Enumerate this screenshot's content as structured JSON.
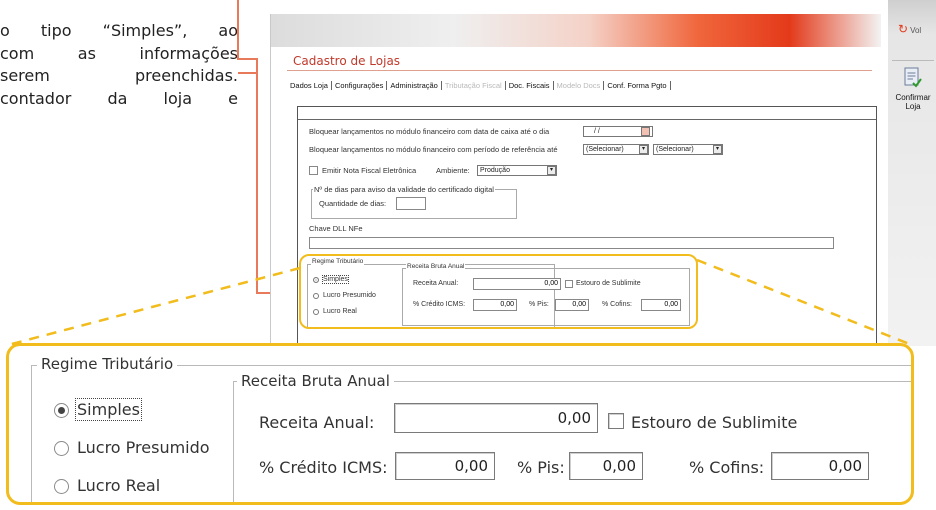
{
  "doc": {
    "lines": [
      [
        "o",
        "tipo",
        "“Simples”,",
        "ao"
      ],
      [
        "com",
        "as",
        "informações"
      ],
      [
        "serem",
        "preenchidas."
      ],
      [
        "contador",
        "da",
        "loja",
        "e"
      ]
    ]
  },
  "colors": {
    "callout": "#e8795b",
    "highlight": "#f1bc1c",
    "title": "#c0392b",
    "header_red": "#e33a1a"
  },
  "screenshot": {
    "title": "Cadastro de Lojas",
    "tabs": [
      "Dados Loja",
      "Configurações",
      "Administração",
      "Tributação Fiscal",
      "Doc. Fiscais",
      "Modelo Docs",
      "Conf. Forma Pgto"
    ],
    "block_date_label": "Bloquear lançamentos no módulo financeiro com data de caixa até o dia",
    "block_date_value": "/ /",
    "block_period_label": "Bloquear lançamentos no módulo financeiro com período de referência até",
    "select_placeholder": "(Selecionar)",
    "nfe_label": "Emitir Nota Fiscal Eletrônica",
    "ambiente_label": "Ambiente:",
    "ambiente_value": "Produção",
    "cert_legend": "Nº de dias para aviso da validade do certificado digital",
    "quantidade_label": "Quantidade de dias:",
    "chave_label": "Chave DLL NFe",
    "regime_legend": "Regime Tributário",
    "receita_legend": "Receita Bruta Anual",
    "regime_options": [
      "Simples",
      "Lucro Presumido",
      "Lucro Real"
    ],
    "receita_label": "Receita Anual:",
    "receita_value": "0,00",
    "estouro_label": "Estouro de Sublimite",
    "credito_label": "% Crédito ICMS:",
    "pis_label": "% Pis:",
    "cofins_label": "% Cofins:",
    "zero": "0,00"
  },
  "sidebar": {
    "voltar_label": "Vol",
    "voltar_icon": "refresh-arrow-icon",
    "confirm_line1": "Confirmar",
    "confirm_line2": "Loja",
    "confirm_icon": "document-check-icon"
  },
  "zoom": {
    "regime_legend": "Regime Tributário",
    "receita_legend": "Receita Bruta Anual",
    "options": [
      "Simples",
      "Lucro Presumido",
      "Lucro Real"
    ],
    "selected_option": "Simples",
    "receita_label": "Receita Anual:",
    "receita_value": "0,00",
    "estouro_label": "Estouro de Sublimite",
    "estouro_checked": false,
    "credito_label": "% Crédito ICMS:",
    "credito_value": "0,00",
    "pis_label": "% Pis:",
    "pis_value": "0,00",
    "cofins_label": "% Cofins:",
    "cofins_value": "0,00"
  }
}
